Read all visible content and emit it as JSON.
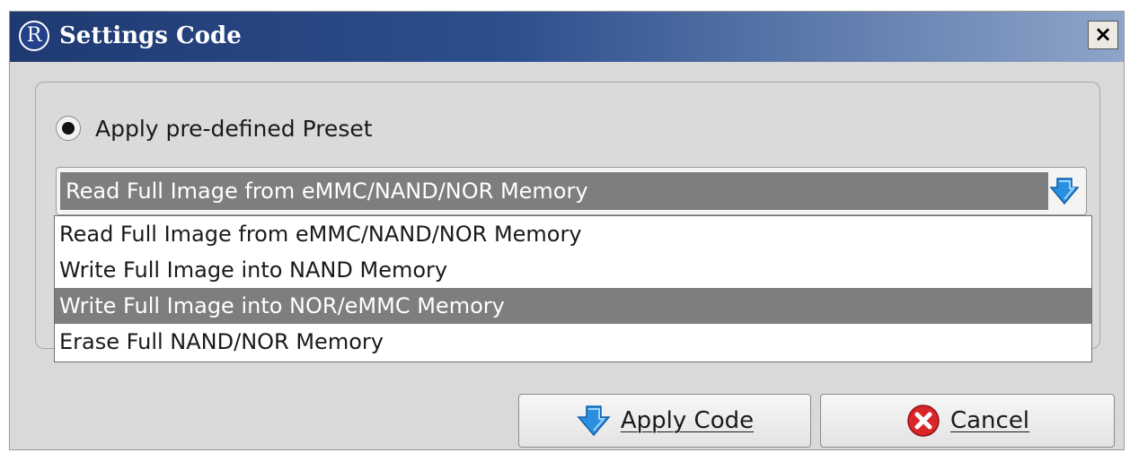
{
  "window": {
    "title": "Settings Code",
    "app_icon": "R",
    "close_label": "×"
  },
  "radio": {
    "label": "Apply pre-defined Preset",
    "checked": true
  },
  "combo": {
    "selected": "Read Full Image from eMMC/NAND/NOR Memory"
  },
  "dropdown": {
    "options": [
      "Read Full Image from eMMC/NAND/NOR Memory",
      "Write Full Image into NAND Memory",
      "Write Full Image into NOR/eMMC Memory",
      "Erase Full NAND/NOR Memory"
    ],
    "highlighted_index": 2
  },
  "buttons": {
    "apply_label": "Apply Code",
    "cancel_label": "Cancel"
  },
  "icons": {
    "apply": "down-arrow-icon",
    "cancel": "error-x-icon",
    "combo": "combo-arrow-icon"
  },
  "colors": {
    "title_start": "#1f3a72",
    "title_end": "#8ea5c9",
    "highlight": "#7e7e7e",
    "arrow": "#2b8fe0",
    "cancel_red": "#d9262b"
  }
}
